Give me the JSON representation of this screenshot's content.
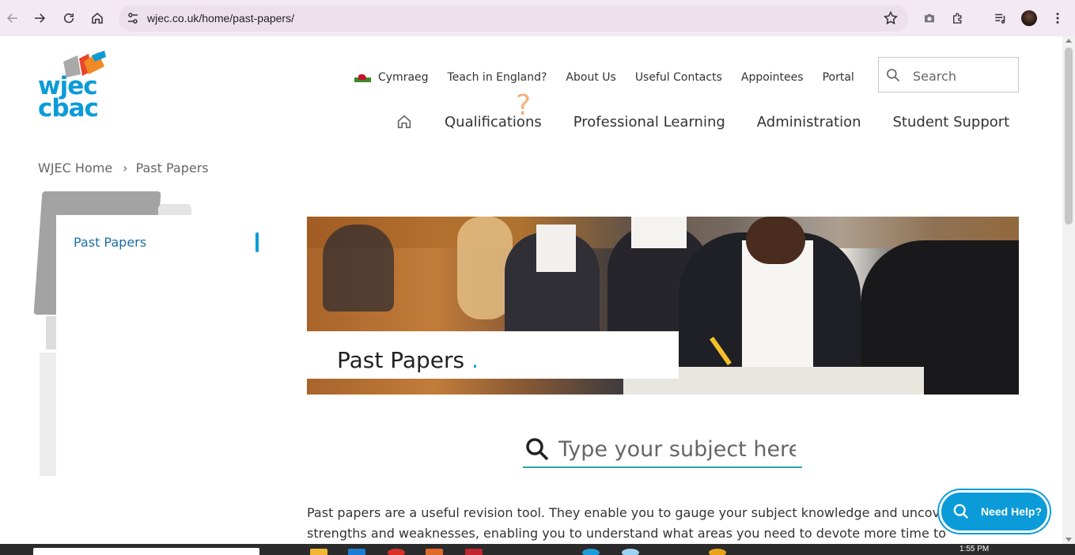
{
  "browser": {
    "url": "wjec.co.uk/home/past-papers/"
  },
  "logo": {
    "line1": "wjec",
    "line2": "cbac"
  },
  "utility_nav": {
    "language": "Cymraeg",
    "items": [
      "Teach in England?",
      "About Us",
      "Useful Contacts",
      "Appointees",
      "Portal"
    ]
  },
  "search": {
    "placeholder": "Search"
  },
  "main_nav": {
    "items": [
      "Qualifications",
      "Professional Learning",
      "Administration",
      "Student Support"
    ]
  },
  "decoration": {
    "question_mark": "?"
  },
  "breadcrumb": {
    "home": "WJEC Home",
    "separator": "›",
    "current": "Past Papers"
  },
  "sidebar": {
    "item": "Past Papers"
  },
  "hero": {
    "title": "Past Papers",
    "dot": "."
  },
  "subject_search": {
    "placeholder": "Type your subject here"
  },
  "intro": {
    "text": "Past papers are a useful revision tool. They enable you to gauge your subject knowledge and uncover strengths and weaknesses, enabling you to understand what areas you need to devote more time to and"
  },
  "help_button": {
    "label": "Need Help?"
  },
  "taskbar": {
    "clock": "1:55 PM"
  },
  "colors": {
    "brand_blue": "#0b9bd8",
    "link_blue": "#1a6fa3",
    "search_underline": "#2aa7a7"
  }
}
